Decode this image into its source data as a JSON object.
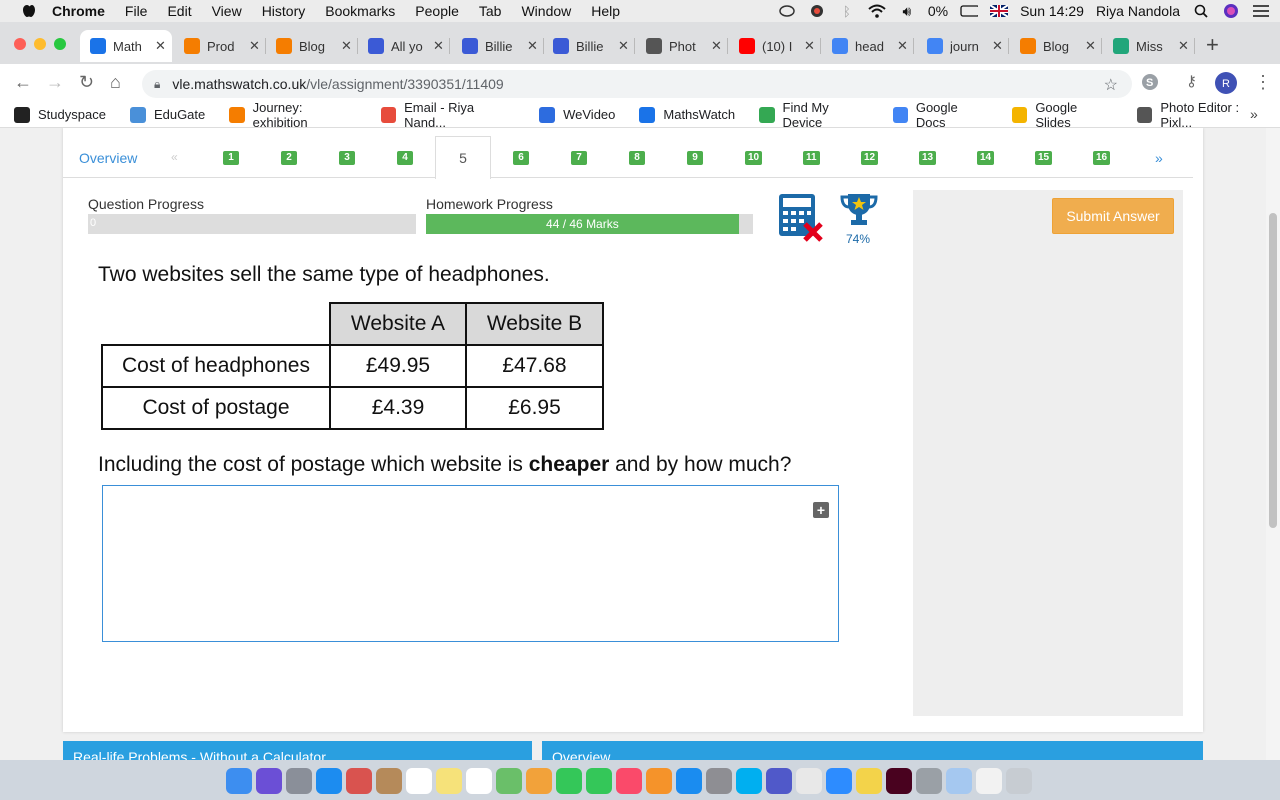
{
  "menubar": {
    "app": "Chrome",
    "items": [
      "File",
      "Edit",
      "View",
      "History",
      "Bookmarks",
      "People",
      "Tab",
      "Window",
      "Help"
    ],
    "battery": "0%",
    "clock": "Sun 14:29",
    "user": "Riya Nandola"
  },
  "tabs": [
    {
      "title": "Math",
      "color": "#1a73e8"
    },
    {
      "title": "Prod",
      "color": "#f57d00"
    },
    {
      "title": "Blog",
      "color": "#f57d00"
    },
    {
      "title": "All yo",
      "color": "#3b5ad6"
    },
    {
      "title": "Billie",
      "color": "#3b5ad6"
    },
    {
      "title": "Billie",
      "color": "#3b5ad6"
    },
    {
      "title": "Phot",
      "color": "#555555"
    },
    {
      "title": "(10) I",
      "color": "#ff0000"
    },
    {
      "title": "head",
      "color": "#4285f4"
    },
    {
      "title": "journ",
      "color": "#4285f4"
    },
    {
      "title": "Blog",
      "color": "#f57d00"
    },
    {
      "title": "Miss",
      "color": "#21a67a"
    }
  ],
  "address": {
    "host": "vle.mathswatch.co.uk",
    "path": "/vle/assignment/3390351/11409"
  },
  "bookmarks": [
    {
      "label": "Studyspace",
      "color": "#222222"
    },
    {
      "label": "EduGate",
      "color": "#4a90d9"
    },
    {
      "label": "Journey: exhibition",
      "color": "#f57d00"
    },
    {
      "label": "Email - Riya Nand...",
      "color": "#e74c3c"
    },
    {
      "label": "WeVideo",
      "color": "#2d6cdf"
    },
    {
      "label": "MathsWatch",
      "color": "#1a73e8"
    },
    {
      "label": "Find My Device",
      "color": "#34a853"
    },
    {
      "label": "Google Docs",
      "color": "#4285f4"
    },
    {
      "label": "Google Slides",
      "color": "#f4b400"
    },
    {
      "label": "Photo Editor : Pixl...",
      "color": "#555555"
    }
  ],
  "question_nav": {
    "overview": "Overview",
    "numbers": [
      "1",
      "2",
      "3",
      "4",
      "6",
      "7",
      "8",
      "9",
      "10",
      "11",
      "12",
      "13",
      "14",
      "15",
      "16"
    ],
    "active": "5",
    "next": "»"
  },
  "progress": {
    "question_label": "Question Progress",
    "question_value": "0",
    "question_fraction": 0,
    "homework_label": "Homework Progress",
    "homework_text": "44 / 46 Marks",
    "homework_fraction": 0.9565,
    "trophy_percent": "74%"
  },
  "question": {
    "intro": "Two websites sell the same type of headphones.",
    "table": {
      "headers": [
        "Website A",
        "Website B"
      ],
      "rows": [
        {
          "label": "Cost of headphones",
          "a": "£49.95",
          "b": "£47.68"
        },
        {
          "label": "Cost of postage",
          "a": "£4.39",
          "b": "£6.95"
        }
      ]
    },
    "prompt_before": "Including the cost of postage which website is ",
    "prompt_bold": "cheaper",
    "prompt_after": " and by how much?"
  },
  "actions": {
    "submit": "Submit Answer"
  },
  "panels": {
    "left_title": "Real-life Problems - Without a Calculator",
    "right_title": "Overview"
  },
  "colors": {
    "accent": "#3a8fd8",
    "green": "#5cb85c",
    "submit": "#f0ad4e"
  }
}
